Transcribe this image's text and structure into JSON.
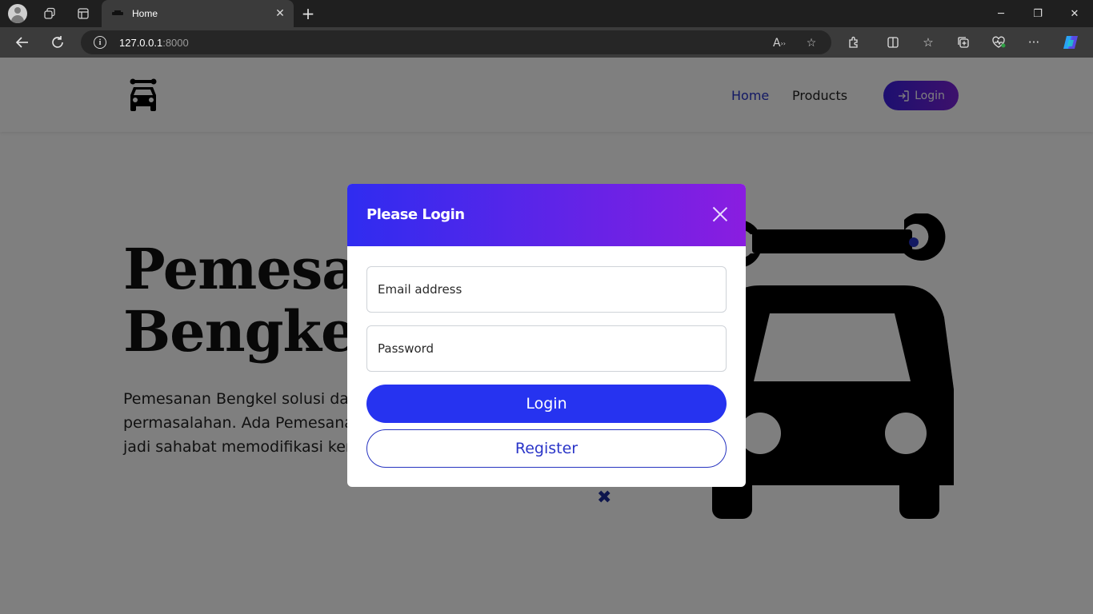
{
  "browser": {
    "tab_title": "Home",
    "tab_close": "✕",
    "new_tab": "+",
    "url_host": "127.0.0.1",
    "url_port": ":8000",
    "minimize": "─",
    "maximize": "❐",
    "close": "✕"
  },
  "site": {
    "nav": {
      "home": "Home",
      "products": "Products",
      "login": "Login"
    },
    "hero": {
      "title_line1": "Pemesanan",
      "title_line2": "Bengkel",
      "text_line1": "Pemesanan Bengkel solusi dari",
      "text_line2": "permasalahan. Ada Pemesanan",
      "text_line3": "jadi sahabat memodifikasi ken"
    },
    "accent_color": "#2633f0"
  },
  "modal": {
    "title": "Please Login",
    "email_label": "Email address",
    "password_label": "Password",
    "login_button": "Login",
    "register_button": "Register"
  }
}
